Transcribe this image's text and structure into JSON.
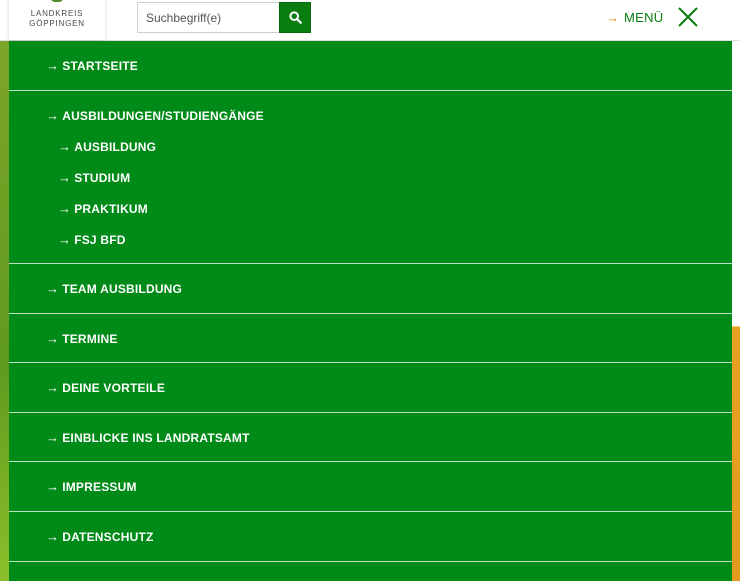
{
  "logo": {
    "line1": "LANDKREIS",
    "line2": "GÖPPINGEN"
  },
  "search": {
    "placeholder": "Suchbegriff(e)",
    "icon": "search-icon"
  },
  "menu_toggle": {
    "arrow": "→",
    "label": "MENÜ",
    "close_icon": "close-icon"
  },
  "colors": {
    "panel": "#008a17",
    "accent": "#e88a12",
    "brand": "#0a7d10"
  },
  "nav": {
    "startseite": "STARTSEITE",
    "ausbildungen": "AUSBILDUNGEN/STUDIENGÄNGE",
    "sub": [
      "AUSBILDUNG",
      "STUDIUM",
      "PRAKTIKUM",
      "FSJ BFD"
    ],
    "team": "TEAM AUSBILDUNG",
    "termine": "TERMINE",
    "vorteile": "DEINE VORTEILE",
    "einblicke": "EINBLICKE INS LANDRATSAMT",
    "impressum": "IMPRESSUM",
    "datenschutz": "DATENSCHUTZ"
  },
  "arrow": "→"
}
